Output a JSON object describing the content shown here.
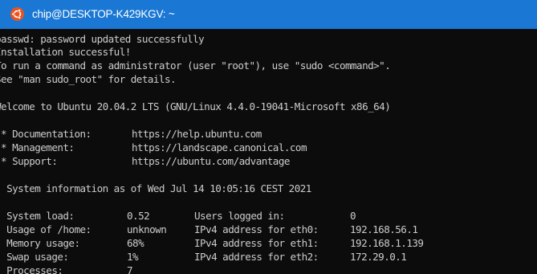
{
  "window": {
    "title": "chip@DESKTOP-K429KGV: ~",
    "icon": "ubuntu-icon",
    "titlebar_color": "#1a78d4",
    "background_color": "#0c0c0c",
    "text_color": "#cccccc"
  },
  "terminal": {
    "passwd_line": "passwd: password updated successfully",
    "install_line": "Installation successful!",
    "sudo_line_1": "To run a command as administrator (user \"root\"), use \"sudo <command>\".",
    "sudo_line_2": "See \"man sudo_root\" for details.",
    "welcome_line": "Welcome to Ubuntu 20.04.2 LTS (GNU/Linux 4.4.0-19041-Microsoft x86_64)",
    "links": [
      {
        "label": " * Documentation:",
        "url": "https://help.ubuntu.com"
      },
      {
        "label": " * Management:",
        "url": "https://landscape.canonical.com"
      },
      {
        "label": " * Support:",
        "url": "https://ubuntu.com/advantage"
      }
    ],
    "sysinfo_header": "  System information as of Wed Jul 14 10:05:16 CEST 2021",
    "stats": [
      {
        "label": "  System load:",
        "value": "0.52",
        "label2": "Users logged in:",
        "value2": "0"
      },
      {
        "label": "  Usage of /home:",
        "value": "unknown",
        "label2": "IPv4 address for eth0:",
        "value2": "192.168.56.1"
      },
      {
        "label": "  Memory usage:",
        "value": "68%",
        "label2": "IPv4 address for eth1:",
        "value2": "192.168.1.139"
      },
      {
        "label": "  Swap usage:",
        "value": "1%",
        "label2": "IPv4 address for eth2:",
        "value2": "172.29.0.1"
      },
      {
        "label": "  Processes:",
        "value": "7",
        "label2": "",
        "value2": ""
      }
    ]
  }
}
